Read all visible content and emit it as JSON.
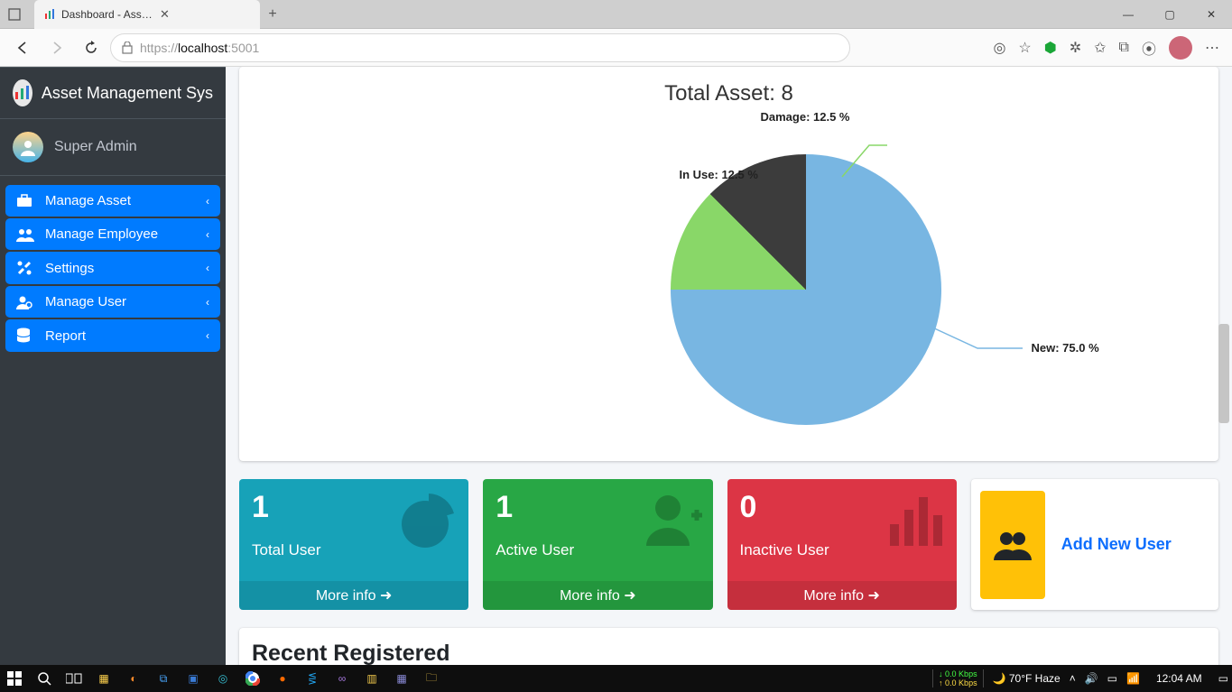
{
  "browser": {
    "tab_title": "Dashboard - Asset Management",
    "url_prefix": "https://",
    "url_host": "localhost",
    "url_suffix": ":5001",
    "window_buttons": {
      "minimize": "—",
      "maximize": "▢",
      "close": "✕"
    }
  },
  "sidebar": {
    "brand": "Asset Management Sys",
    "user": "Super Admin",
    "items": [
      {
        "label": "Manage Asset",
        "icon": "briefcase-icon"
      },
      {
        "label": "Manage Employee",
        "icon": "users-icon"
      },
      {
        "label": "Settings",
        "icon": "tools-icon"
      },
      {
        "label": "Manage User",
        "icon": "user-cog-icon"
      },
      {
        "label": "Report",
        "icon": "database-icon"
      }
    ]
  },
  "chart_title": "Total Asset: 8",
  "chart_data": {
    "type": "pie",
    "title": "Total Asset: 8",
    "series": [
      {
        "name": "New",
        "value": 75.0,
        "label": "New: 75.0 %",
        "color": "#78b6e2"
      },
      {
        "name": "Damage",
        "value": 12.5,
        "label": "Damage: 12.5 %",
        "color": "#89d768"
      },
      {
        "name": "In Use",
        "value": 12.5,
        "label": "In Use: 12.5 %",
        "color": "#3c3c3c"
      }
    ]
  },
  "stats": {
    "total_user": {
      "value": "1",
      "label": "Total User",
      "footer": "More info"
    },
    "active_user": {
      "value": "1",
      "label": "Active User",
      "footer": "More info"
    },
    "inactive_user": {
      "value": "0",
      "label": "Inactive User",
      "footer": "More info"
    },
    "add_user": "Add New User"
  },
  "section_recent": "Recent Registered",
  "taskbar": {
    "net_down": "0.0 Kbps",
    "net_up": "0.0 Kbps",
    "weather": "70°F Haze",
    "time": "12:04 AM"
  }
}
